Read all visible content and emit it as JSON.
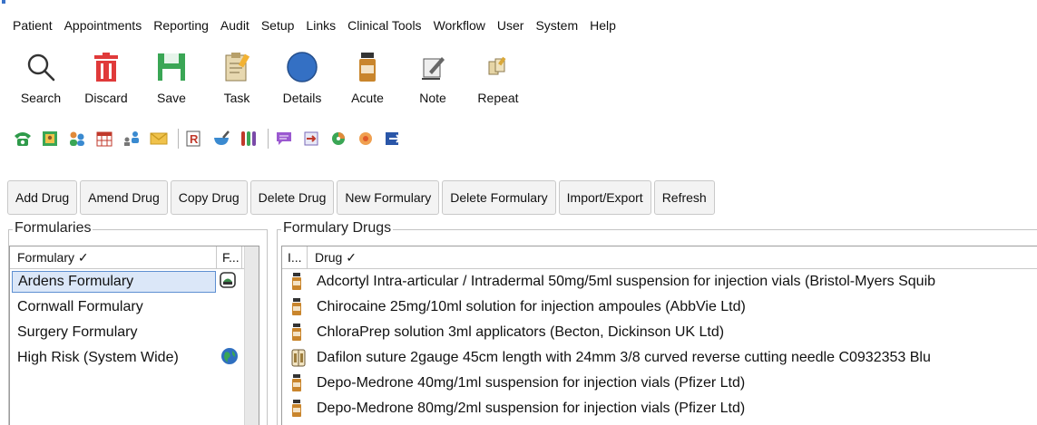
{
  "menu": [
    "Patient",
    "Appointments",
    "Reporting",
    "Audit",
    "Setup",
    "Links",
    "Clinical Tools",
    "Workflow",
    "User",
    "System",
    "Help"
  ],
  "toolbar": [
    {
      "label": "Search",
      "icon": "search-icon"
    },
    {
      "label": "Discard",
      "icon": "trash-icon"
    },
    {
      "label": "Save",
      "icon": "save-icon"
    },
    {
      "label": "Task",
      "icon": "task-icon"
    },
    {
      "label": "Details",
      "icon": "details-circle-icon"
    },
    {
      "label": "Acute",
      "icon": "medicine-bottle-icon"
    },
    {
      "label": "Note",
      "icon": "note-pencil-icon"
    },
    {
      "label": "Repeat",
      "icon": "repeat-icon"
    }
  ],
  "actions": [
    "Add Drug",
    "Amend Drug",
    "Copy Drug",
    "Delete Drug",
    "New Formulary",
    "Delete Formulary",
    "Import/Export",
    "Refresh"
  ],
  "formularies": {
    "title": "Formularies",
    "col_formulary": "Formulary ✓",
    "col_f": "F...",
    "items": [
      {
        "name": "Ardens Formulary",
        "icon": "formulary-badge-icon",
        "selected": true
      },
      {
        "name": "Cornwall Formulary",
        "icon": "",
        "selected": false
      },
      {
        "name": "Surgery Formulary",
        "icon": "",
        "selected": false
      },
      {
        "name": "High Risk (System Wide)",
        "icon": "globe-icon",
        "selected": false
      }
    ]
  },
  "drugs": {
    "title": "Formulary Drugs",
    "col_i": "I...",
    "col_drug": "Drug ✓",
    "items": [
      {
        "icon": "medicine-bottle-icon",
        "text": "Adcortyl Intra-articular / Intradermal 50mg/5ml suspension for injection vials (Bristol-Myers Squib"
      },
      {
        "icon": "medicine-bottle-icon",
        "text": "Chirocaine 25mg/10ml solution for injection ampoules (AbbVie Ltd)"
      },
      {
        "icon": "medicine-bottle-icon",
        "text": "ChloraPrep solution 3ml applicators (Becton, Dickinson UK Ltd)"
      },
      {
        "icon": "appliance-icon",
        "text": "Dafilon suture 2gauge 45cm length with 24mm 3/8 curved reverse cutting needle C0932353 Blu"
      },
      {
        "icon": "medicine-bottle-icon",
        "text": "Depo-Medrone 40mg/1ml suspension for injection vials (Pfizer Ltd)"
      },
      {
        "icon": "medicine-bottle-icon",
        "text": "Depo-Medrone 80mg/2ml suspension for injection vials (Pfizer Ltd)"
      }
    ]
  }
}
